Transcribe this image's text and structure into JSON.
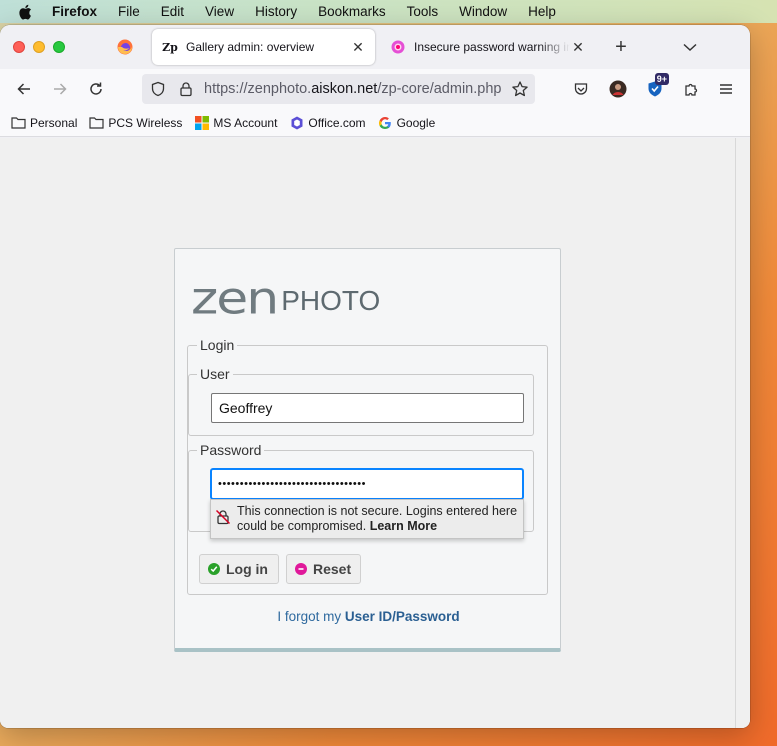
{
  "menubar": {
    "app": "Firefox",
    "items": [
      "File",
      "Edit",
      "View",
      "History",
      "Bookmarks",
      "Tools",
      "Window",
      "Help"
    ]
  },
  "tabs": [
    {
      "title": "Gallery admin: overview",
      "favicon": "zenphoto-icon",
      "active": true
    },
    {
      "title": "Insecure password warning in Fi",
      "favicon": "firefox-help-icon",
      "active": false
    }
  ],
  "urlbar": {
    "prefix": "https://zenphoto.",
    "domain": "aiskon.net",
    "path": "/zp-core/admin.php"
  },
  "toolbar": {
    "extension_badge": "9+"
  },
  "bookmarks": [
    {
      "label": "Personal",
      "icon": "folder-icon"
    },
    {
      "label": "PCS Wireless",
      "icon": "folder-icon"
    },
    {
      "label": "MS Account",
      "icon": "microsoft-icon"
    },
    {
      "label": "Office.com",
      "icon": "office-icon"
    },
    {
      "label": "Google",
      "icon": "google-icon"
    }
  ],
  "login": {
    "logo_zen": "zen",
    "logo_photo": "PHOTO",
    "legend": "Login",
    "user_legend": "User",
    "user_value": "Geoffrey",
    "password_legend": "Password",
    "password_value": "••••••••••••••••••••••••••••••••••",
    "warning_text": "This connection is not secure. Logins entered here could be compromised.",
    "warning_link": "Learn More",
    "login_button": "Log in",
    "reset_button": "Reset",
    "forgot_prefix": "I forgot my ",
    "forgot_link": "User ID/Password"
  },
  "colors": {
    "accent_focus": "#0a84ff",
    "link": "#2f6a9f",
    "login_ok": "#2aa12a",
    "reset": "#e0189a"
  }
}
